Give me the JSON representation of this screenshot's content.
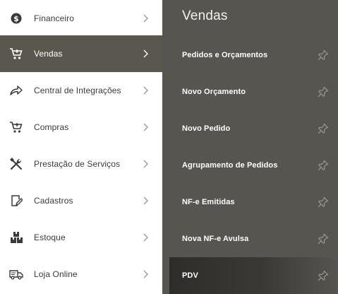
{
  "menu": {
    "items": [
      {
        "label": "Financeiro",
        "icon": "dollar-circle-icon"
      },
      {
        "label": "Vendas",
        "icon": "cart-icon",
        "active": true
      },
      {
        "label": "Central de Integrações",
        "icon": "share-arrow-icon"
      },
      {
        "label": "Compras",
        "icon": "cart-icon"
      },
      {
        "label": "Prestação de Serviços",
        "icon": "tools-icon"
      },
      {
        "label": "Cadastros",
        "icon": "edit-icon"
      },
      {
        "label": "Estoque",
        "icon": "boxes-icon"
      },
      {
        "label": "Loja Online",
        "icon": "truck-icon"
      }
    ]
  },
  "submenu": {
    "title": "Vendas",
    "items": [
      {
        "label": "Pedidos e Orçamentos"
      },
      {
        "label": "Novo Orçamento"
      },
      {
        "label": "Novo Pedido"
      },
      {
        "label": "Agrupamento de Pedidos"
      },
      {
        "label": "NF-e Emitidas"
      },
      {
        "label": "Nova NF-e Avulsa"
      },
      {
        "label": "PDV",
        "active": true
      }
    ]
  },
  "colors": {
    "panel": "#575550",
    "active_menu": "#5a574f",
    "text_dark": "#3a3a3a"
  }
}
